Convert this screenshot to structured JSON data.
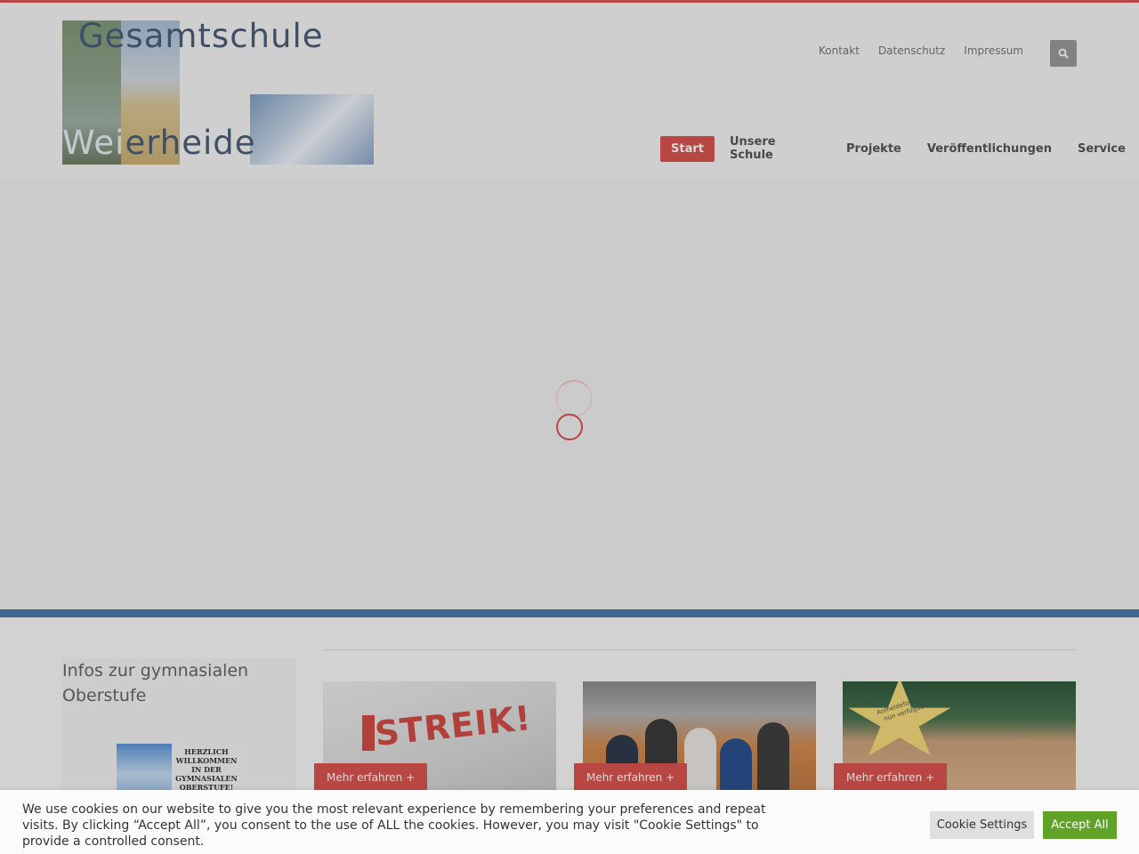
{
  "logo": {
    "line1": "Gesamtschule",
    "line2_a": "Wei",
    "line2_b": "erheide"
  },
  "top_nav": [
    {
      "label": "Kontakt"
    },
    {
      "label": "Datenschutz"
    },
    {
      "label": "Impressum"
    }
  ],
  "search_icon": "search-icon",
  "main_nav": [
    {
      "label": "Start",
      "active": true
    },
    {
      "label": "Unsere Schule"
    },
    {
      "label": "Projekte"
    },
    {
      "label": "Veröffentlichungen"
    },
    {
      "label": "Service"
    }
  ],
  "sidebar": {
    "title": "Infos zur gymnasialen Oberstufe",
    "poster_text": "HERZLICH WILLKOMMEN IN DER GYMNASIALEN OBERSTUFE!"
  },
  "cards": [
    {
      "image_text": "STREIK!",
      "button": "Mehr erfahren +"
    },
    {
      "button": "Mehr erfahren +"
    },
    {
      "image_text": "Anmeldeformular nun verfügbar",
      "button": "Mehr erfahren +"
    }
  ],
  "cookie": {
    "text": "We use cookies on our website to give you the most relevant experience by remembering your preferences and repeat visits. By clicking “Accept All”, you consent to the use of ALL the cookies. However, you may visit \"Cookie Settings\" to provide a controlled consent.",
    "settings_label": "Cookie Settings",
    "accept_label": "Accept All"
  },
  "colors": {
    "accent": "#d9534f",
    "band": "#4a78ad",
    "accept": "#61a229"
  }
}
